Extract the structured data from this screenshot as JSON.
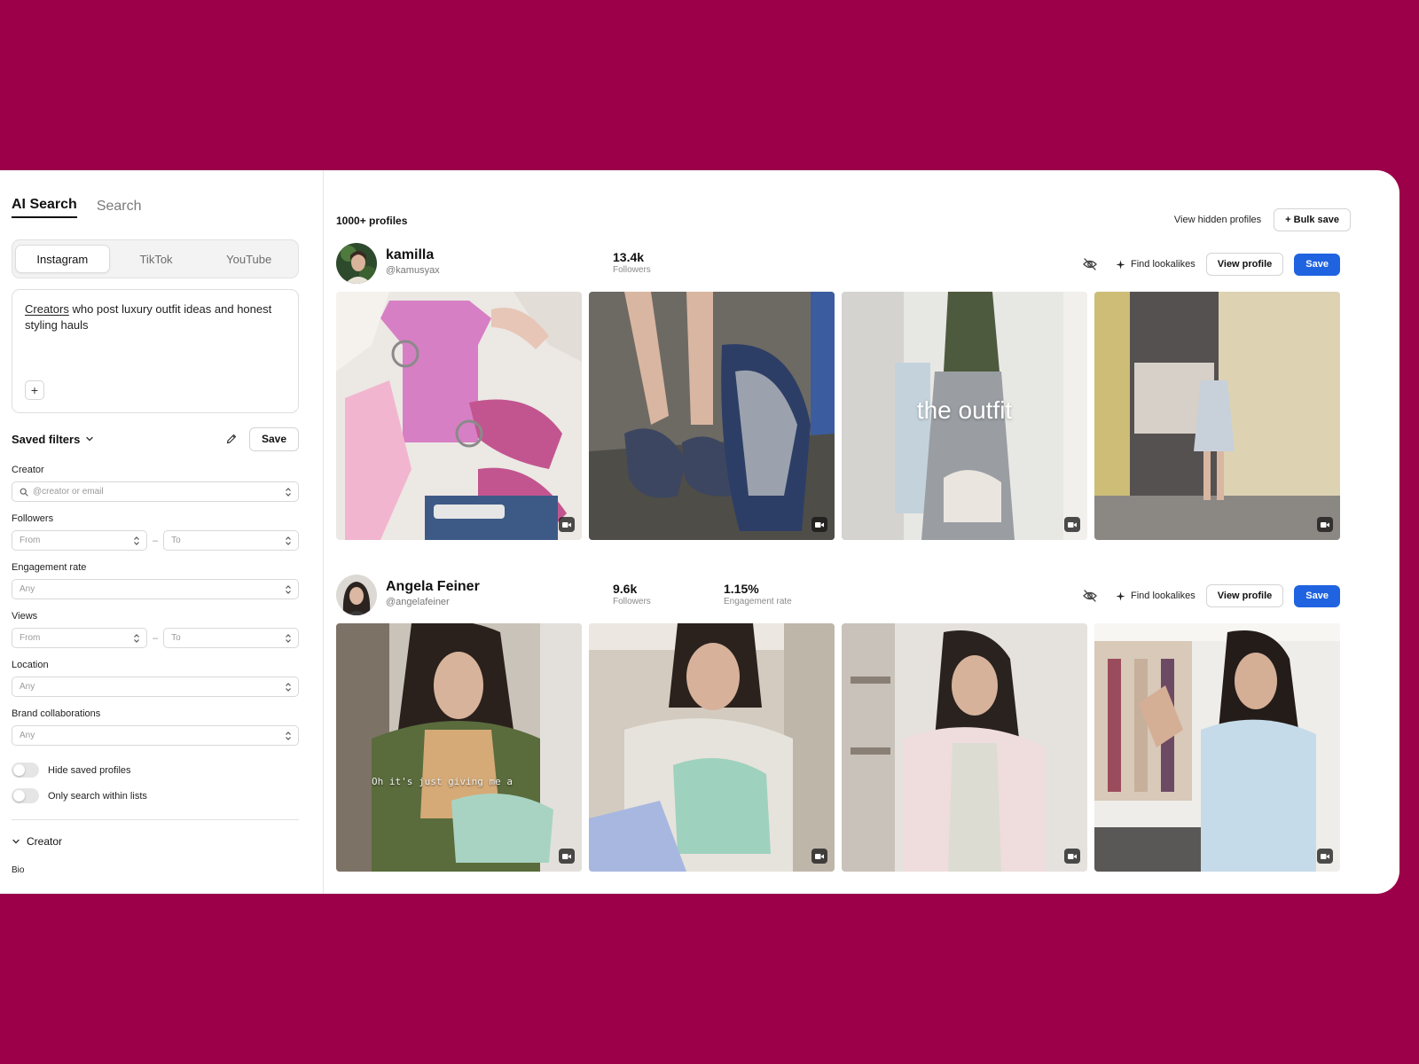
{
  "sidebar": {
    "tabs": [
      {
        "label": "AI Search"
      },
      {
        "label": "Search"
      }
    ],
    "platforms": [
      {
        "label": "Instagram"
      },
      {
        "label": "TikTok"
      },
      {
        "label": "YouTube"
      }
    ],
    "prompt": {
      "highlight": "Creators",
      "rest": " who post luxury outfit ideas and honest styling hauls",
      "add_label": "+"
    },
    "saved_filters": {
      "label": "Saved filters",
      "save_label": "Save"
    },
    "filters": {
      "creator": {
        "label": "Creator",
        "placeholder": "@creator or email"
      },
      "followers": {
        "label": "Followers",
        "from": "From",
        "to": "To"
      },
      "engagement": {
        "label": "Engagement rate",
        "value": "Any"
      },
      "views": {
        "label": "Views",
        "from": "From",
        "to": "To"
      },
      "location": {
        "label": "Location",
        "value": "Any"
      },
      "brands": {
        "label": "Brand collaborations",
        "value": "Any"
      }
    },
    "toggles": [
      {
        "label": "Hide saved profiles"
      },
      {
        "label": "Only search within lists"
      }
    ],
    "section": {
      "label": "Creator",
      "bio_label": "Bio"
    }
  },
  "main": {
    "count": "1000+ profiles",
    "view_hidden": "View hidden profiles",
    "bulk_save": "+ Bulk save",
    "profiles": [
      {
        "name": "kamilla",
        "handle": "@kamusyax",
        "followers_value": "13.4k",
        "followers_label": "Followers",
        "find_lookalikes": "Find lookalikes",
        "view_profile": "View profile",
        "save": "Save",
        "overlay_text": "the outfit"
      },
      {
        "name": "Angela Feiner",
        "handle": "@angelafeiner",
        "followers_value": "9.6k",
        "followers_label": "Followers",
        "engagement_value": "1.15%",
        "engagement_label": "Engagement rate",
        "find_lookalikes": "Find lookalikes",
        "view_profile": "View profile",
        "save": "Save",
        "caption_text": "Oh it's just giving me a"
      }
    ]
  },
  "colors": {
    "background": "#9c0049",
    "primary_button": "#1f63e0"
  },
  "icons": [
    "search-icon",
    "chevron-updown-icon",
    "chevron-down-icon",
    "pencil-icon",
    "eye-off-icon",
    "sparkle-icon",
    "video-icon"
  ]
}
